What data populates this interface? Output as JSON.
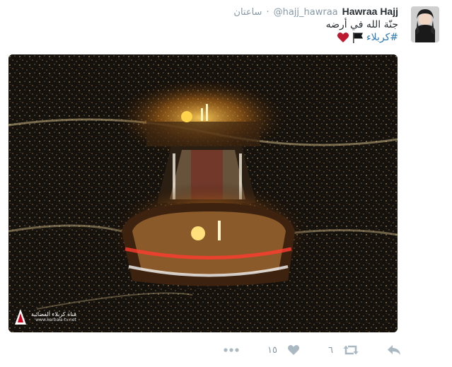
{
  "tweet": {
    "user": {
      "fullname": "Hawraa Hajj",
      "username": "@hajj_hawraa"
    },
    "separator": "·",
    "time": "ساعتان",
    "text": "جنّة الله في أرضه",
    "hashtag": "#كربلاء",
    "emoji": [
      "black-flag-icon",
      "red-heart-icon"
    ],
    "media": {
      "watermark_title": "قناة كربلاء الفضائية",
      "watermark_url": "www.karbala-tv.net"
    },
    "actions": {
      "retweet_count": "٦",
      "like_count": "١٥"
    }
  },
  "colors": {
    "link": "#2b7bb9",
    "muted": "#8899a6",
    "heart": "#e0245e"
  }
}
